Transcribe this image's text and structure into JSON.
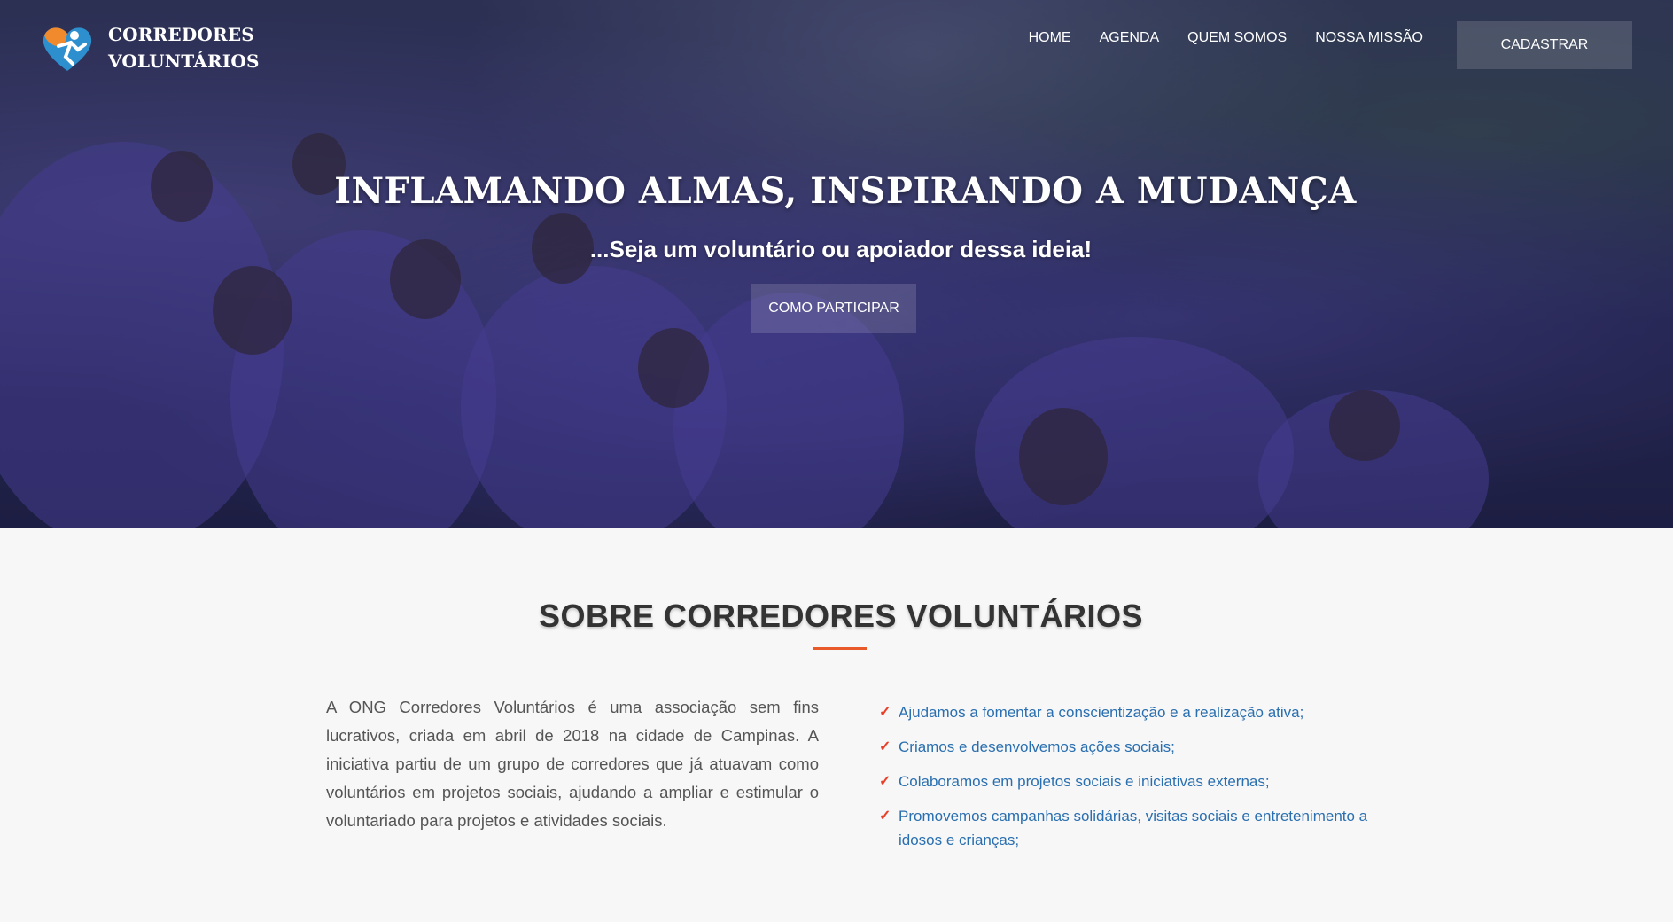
{
  "brand": {
    "line1": "CORREDORES",
    "line2": "VOLUNTÁRIOS",
    "logo_icon": "heart-runner-icon"
  },
  "nav": {
    "items": [
      "HOME",
      "AGENDA",
      "QUEM SOMOS",
      "NOSSA MISSÃO"
    ]
  },
  "header_cta": "CADASTRAR",
  "hero": {
    "title": "INFLAMANDO ALMAS, INSPIRANDO A MUDANÇA",
    "subtitle": "...Seja um voluntário ou apoiador dessa ideia!",
    "button": "COMO PARTICIPAR"
  },
  "about": {
    "title": "SOBRE CORREDORES VOLUNTÁRIOS",
    "text": "A ONG Corredores Voluntários é uma associação sem fins lucrativos, criada em abril de 2018 na cidade de Campinas. A iniciativa partiu de um grupo de corredores que já atuavam como voluntários em projetos sociais, ajudando a ampliar e estimular o voluntariado para projetos e atividades sociais.",
    "list": [
      "Ajudamos a fomentar a conscientização e a realização ativa;",
      "Criamos e desenvolvemos ações sociais;",
      "Colaboramos em projetos sociais e iniciativas externas;",
      "Promovemos campanhas solidárias, visitas sociais e entretenimento a idosos e crianças;"
    ]
  },
  "colors": {
    "accent": "#e85a2a",
    "link": "#2a6fb0",
    "check": "#e8412a"
  }
}
